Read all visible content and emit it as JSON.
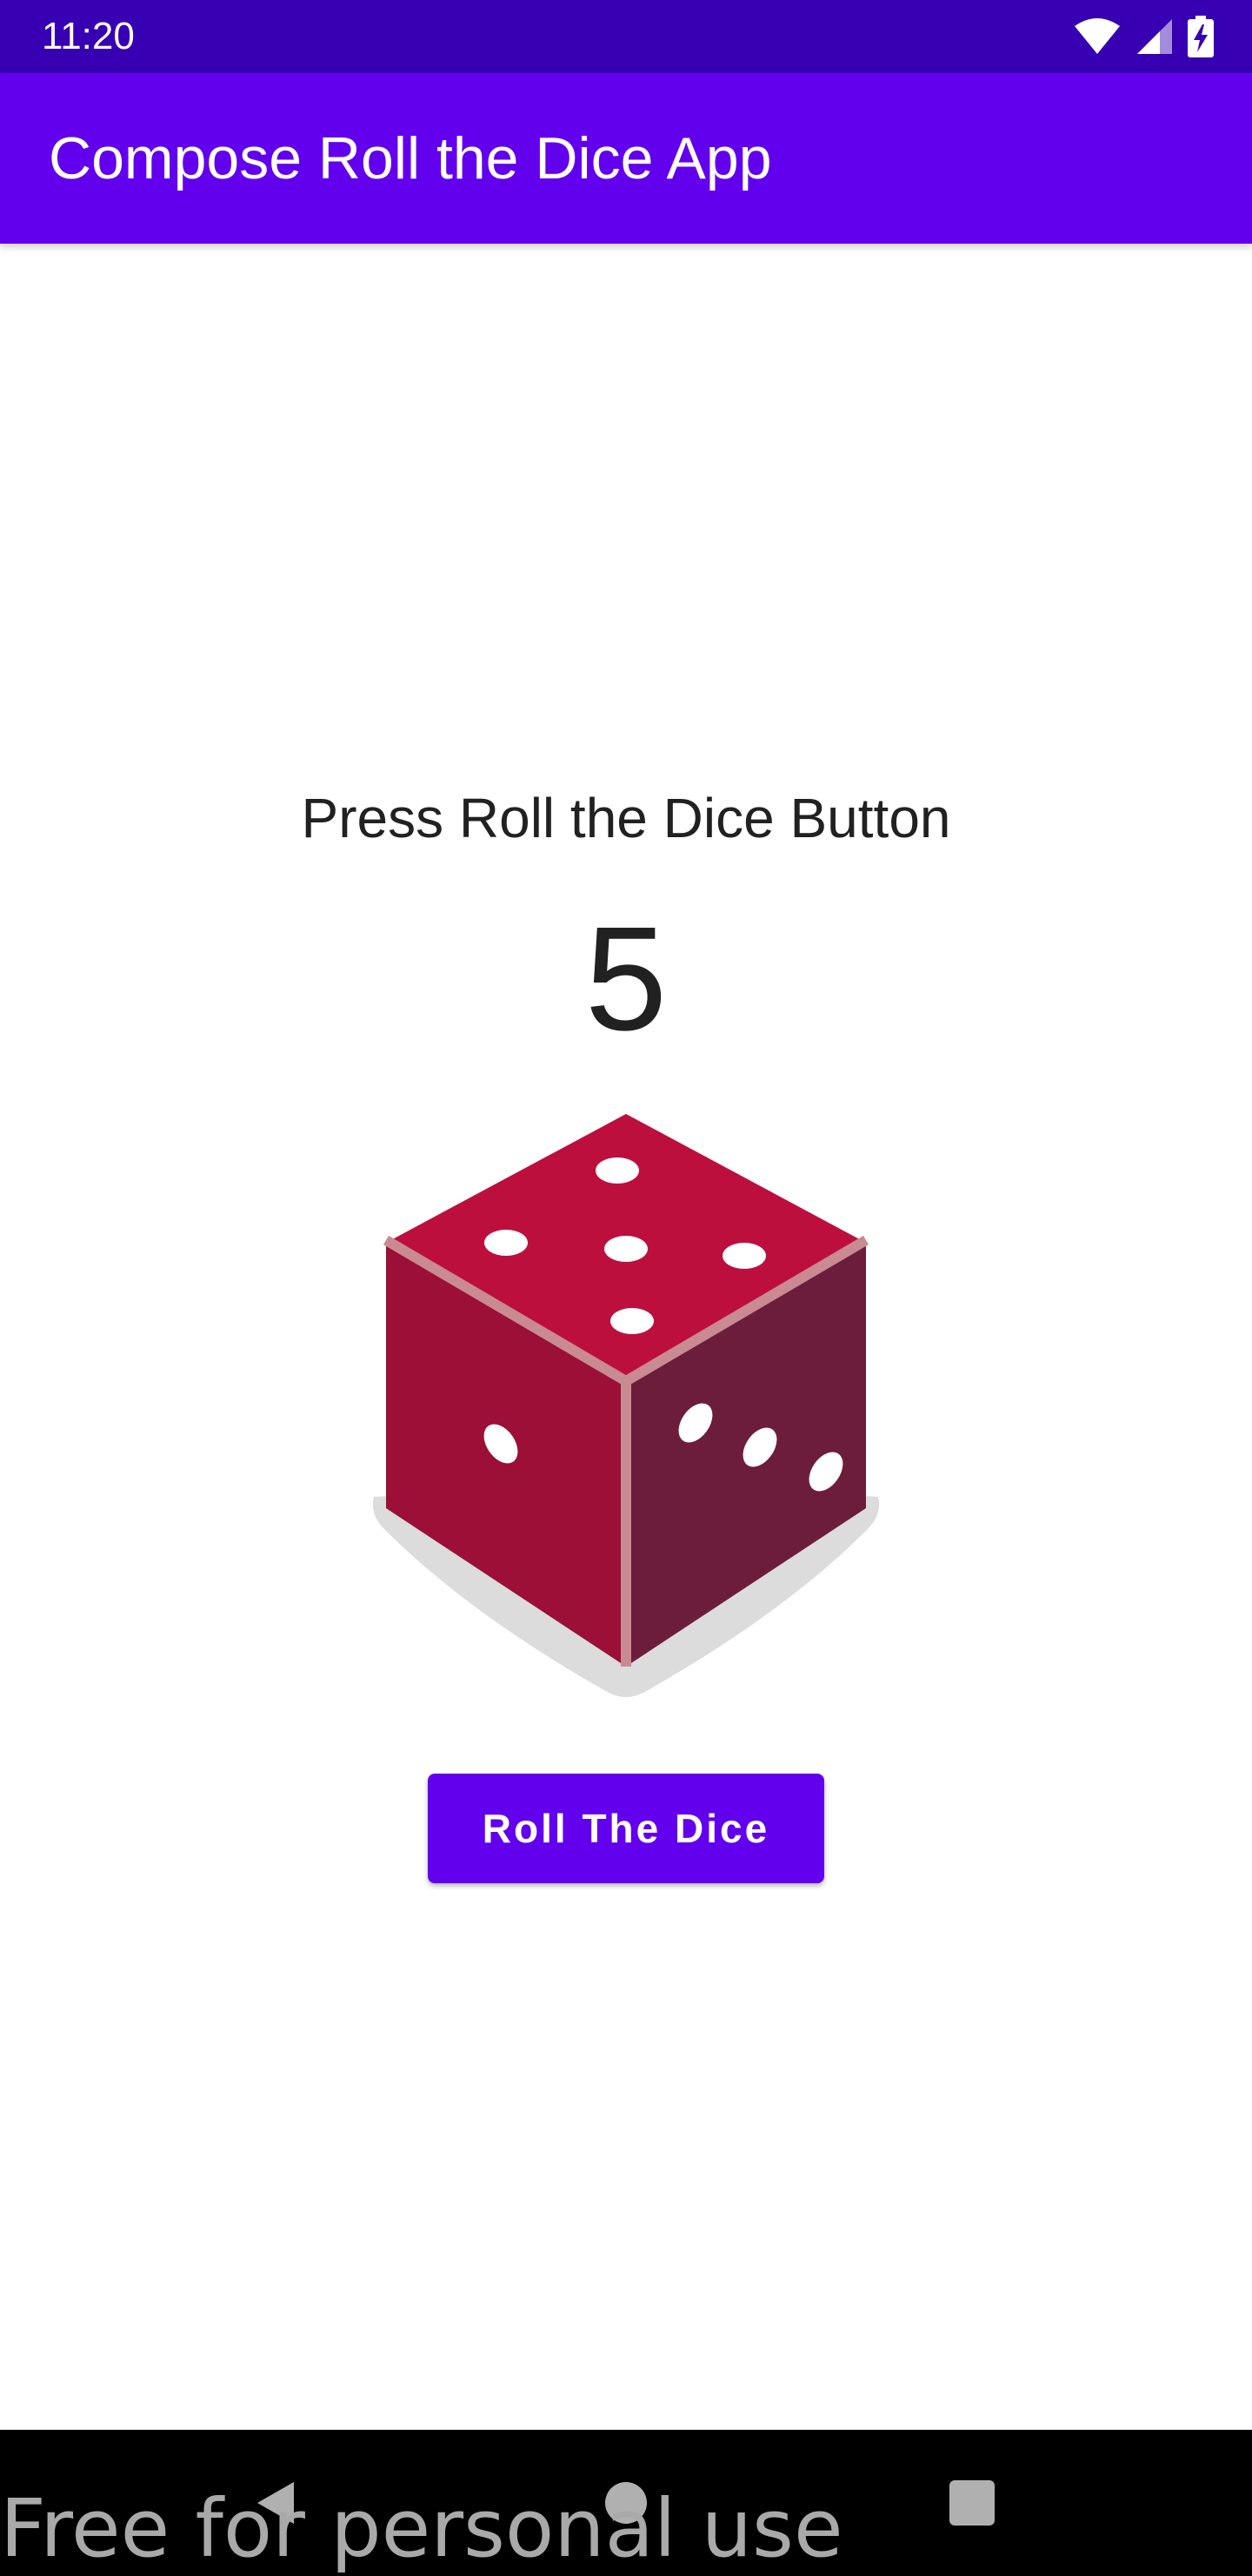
{
  "status_bar": {
    "time": "11:20",
    "icons": [
      "wifi-icon",
      "cellular-signal-icon",
      "battery-charging-icon"
    ]
  },
  "app_bar": {
    "title": "Compose Roll the Dice App",
    "color": "#6200ee"
  },
  "main": {
    "prompt": "Press Roll the Dice Button",
    "dice_value": "5",
    "dice_image": {
      "icon": "dice-icon",
      "top_face_pips": 5,
      "left_face_pips": 1,
      "right_face_pips": 3,
      "colors": {
        "top": "#bd0f3e",
        "left": "#9c0f36",
        "right": "#6d1d3c",
        "edge": "#c98a92",
        "shadow": "#dcdcdc"
      }
    },
    "roll_button_label": "Roll The Dice"
  },
  "nav_bar": {
    "buttons": [
      "back-icon",
      "home-icon",
      "recents-icon"
    ]
  },
  "watermark": "Free for personal use",
  "colors": {
    "status_bar": "#3700b3",
    "primary": "#6200ee",
    "text": "#212121"
  }
}
